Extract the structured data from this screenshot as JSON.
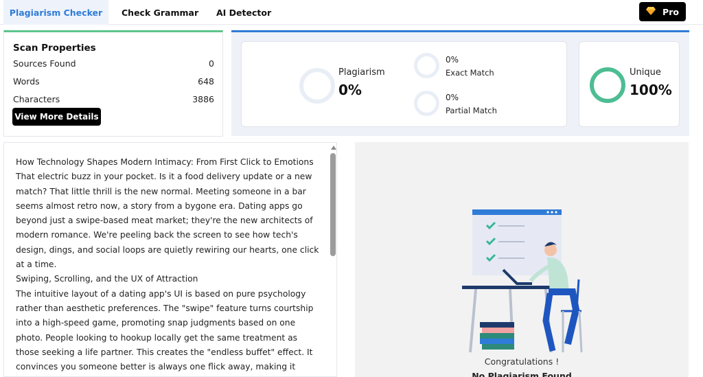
{
  "tabs": [
    {
      "label": "Plagiarism Checker",
      "active": true
    },
    {
      "label": "Check Grammar",
      "active": false
    },
    {
      "label": "AI Detector",
      "active": false
    }
  ],
  "pro_button": {
    "label": "Pro",
    "icon": "diamond-icon"
  },
  "scan": {
    "title": "Scan Properties",
    "rows": [
      {
        "label": "Sources Found",
        "value": "0"
      },
      {
        "label": "Words",
        "value": "648"
      },
      {
        "label": "Characters",
        "value": "3886"
      }
    ],
    "button": "View More Details"
  },
  "results": {
    "plagiarism": {
      "label": "Plagiarism",
      "value": "0%"
    },
    "exact": {
      "value": "0%",
      "label": "Exact Match"
    },
    "partial": {
      "value": "0%",
      "label": "Partial Match"
    },
    "unique": {
      "label": "Unique",
      "value": "100%"
    }
  },
  "text": {
    "paragraphs": [
      "How Technology Shapes Modern Intimacy: From First Click to Emotions",
      "That electric buzz in your pocket. Is it a food delivery update or a new match? That little thrill is the new normal. Meeting someone in a bar seems almost retro now, a story from a bygone era. Dating apps go beyond just a swipe-based meat market; they're the new architects of modern romance. We're peeling back the screen to see how tech's design, dings, and social loops are quietly rewiring our hearts, one click at a time.",
      "Swiping, Scrolling, and the UX of Attraction",
      "The intuitive layout of a dating app's UI is based on pure psychology rather than aesthetic preferences. The \"swipe\" feature turns courtship into a high-speed game, promoting snap judgments based on one photo. People looking to hookup locally get the same treatment as those seeking a life partner. This creates the \"endless buffet\" effect. It convinces you someone better is always one flick away, making it harder to settle."
    ]
  },
  "result_panel": {
    "congrats": "Congratulations !",
    "message": "No Plagiarism Found"
  },
  "colors": {
    "accent_blue": "#2f7bd8",
    "green": "#5cc48b",
    "unique_ring": "#4dbd94"
  }
}
